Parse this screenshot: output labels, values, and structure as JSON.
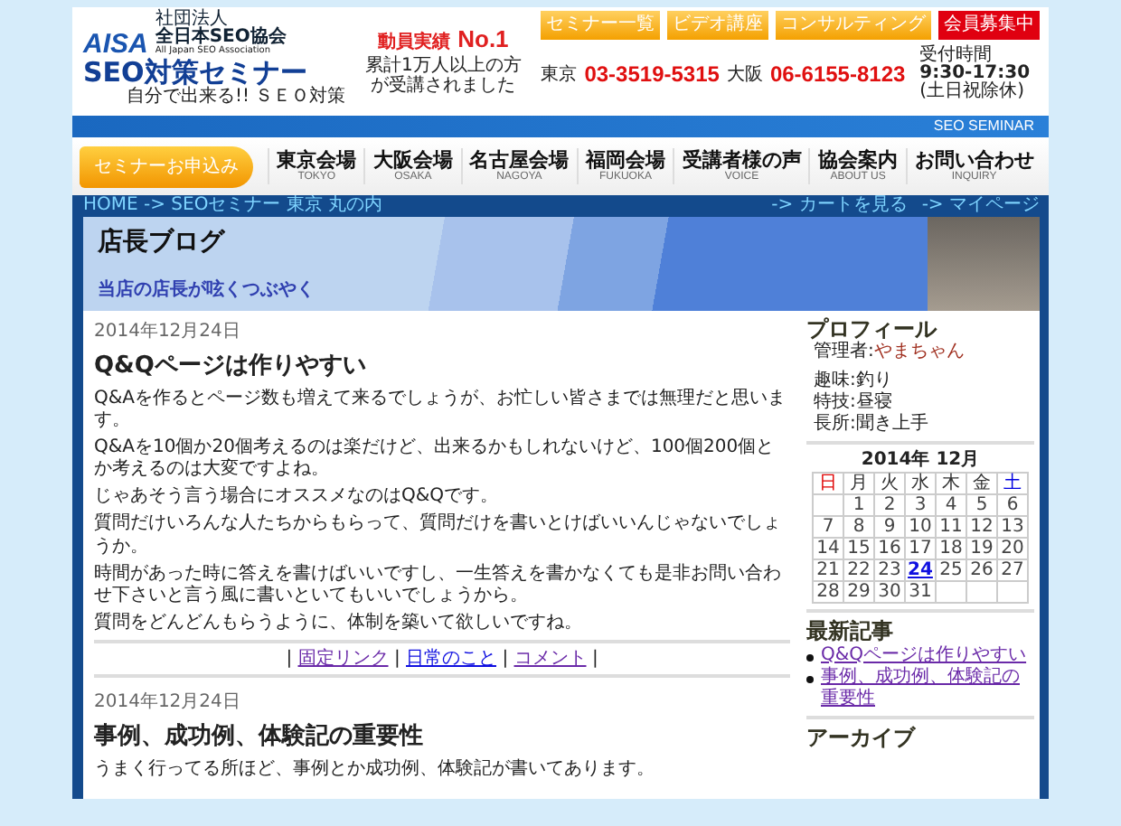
{
  "header": {
    "logo_mark": "AISA",
    "org_type": "社団法人",
    "org_name": "全日本SEO協会",
    "org_en": "All Japan SEO Association",
    "site_title": "SEO対策セミナー",
    "tagline": "自分で出来る!! ＳＥＯ対策",
    "award_label": "動員実績",
    "award_rank": "No.1",
    "award_text": "累計1万人以上の方が受講されました",
    "top_buttons": [
      {
        "label": "セミナー一覧",
        "kind": "normal"
      },
      {
        "label": "ビデオ講座",
        "kind": "normal"
      },
      {
        "label": "コンサルティング",
        "kind": "normal"
      },
      {
        "label": "会員募集中",
        "kind": "highlight"
      }
    ],
    "phones": [
      {
        "city": "東京",
        "number": "03-3519-5315"
      },
      {
        "city": "大阪",
        "number": "06-6155-8123"
      }
    ],
    "hours_label": "受付時間",
    "hours": "9:30-17:30",
    "hours_note": "(土日祝除休)",
    "band_text": "SEO SEMINAR"
  },
  "nav": {
    "cta": "セミナーお申込み",
    "items": [
      {
        "label": "東京会場",
        "sub": "TOKYO"
      },
      {
        "label": "大阪会場",
        "sub": "OSAKA"
      },
      {
        "label": "名古屋会場",
        "sub": "NAGOYA"
      },
      {
        "label": "福岡会場",
        "sub": "FUKUOKA"
      },
      {
        "label": "受講者様の声",
        "sub": "VOICE"
      },
      {
        "label": "協会案内",
        "sub": "ABOUT US"
      },
      {
        "label": "お問い合わせ",
        "sub": "INQUIRY"
      }
    ]
  },
  "breadcrumb": "HOME -> SEOセミナー 東京 丸の内",
  "utility_links": [
    "-> カートを見る",
    "-> マイページ"
  ],
  "banner": {
    "title": "店長ブログ",
    "subtitle": "当店の店長が呟くつぶやく"
  },
  "posts": [
    {
      "date": "2014年12月24日",
      "title": "Q&Qページは作りやすい",
      "paragraphs": [
        "Q&Aを作るとページ数も増えて来るでしょうが、お忙しい皆さまでは無理だと思います。",
        "Q&Aを10個か20個考えるのは楽だけど、出来るかもしれないけど、100個200個とか考えるのは大変ですよね。",
        "じゃあそう言う場合にオススメなのはQ&Qです。",
        "質問だけいろんな人たちからもらって、質問だけを書いとけばいいんじゃないでしょうか。",
        "時間があった時に答えを書けばいいですし、一生答えを書かなくても是非お問い合わせ下さいと言う風に書いといてもいいでしょうから。",
        "質問をどんどんもらうように、体制を築いて欲しいですね。"
      ],
      "separator": "|",
      "links": [
        {
          "label": "固定リンク",
          "visited": true
        },
        {
          "label": "日常のこと",
          "visited": false
        },
        {
          "label": "コメント",
          "visited": true
        }
      ]
    },
    {
      "date": "2014年12月24日",
      "title": "事例、成功例、体験記の重要性",
      "paragraphs": [
        "うまく行ってる所ほど、事例とか成功例、体験記が書いてあります。"
      ]
    }
  ],
  "sidebar": {
    "profile_title": "プロフィール",
    "admin_label": "管理者:",
    "admin_name": "やまちゃん",
    "details": [
      "趣味:釣り",
      "特技:昼寝",
      "長所:聞き上手"
    ],
    "calendar": {
      "title": "2014年 12月",
      "weekdays": [
        {
          "label": "日",
          "color": "#e00000"
        },
        {
          "label": "月",
          "color": "#333333"
        },
        {
          "label": "火",
          "color": "#333333"
        },
        {
          "label": "水",
          "color": "#333333"
        },
        {
          "label": "木",
          "color": "#333333"
        },
        {
          "label": "金",
          "color": "#333333"
        },
        {
          "label": "土",
          "color": "#0000e0"
        }
      ],
      "weeks": [
        [
          {
            "kind": "blank"
          },
          {
            "kind": "day",
            "day": "1",
            "linked": false
          },
          {
            "kind": "day",
            "day": "2",
            "linked": false
          },
          {
            "kind": "day",
            "day": "3",
            "linked": false
          },
          {
            "kind": "day",
            "day": "4",
            "linked": false
          },
          {
            "kind": "day",
            "day": "5",
            "linked": false
          },
          {
            "kind": "day",
            "day": "6",
            "linked": false
          }
        ],
        [
          {
            "kind": "day",
            "day": "7",
            "linked": false
          },
          {
            "kind": "day",
            "day": "8",
            "linked": false
          },
          {
            "kind": "day",
            "day": "9",
            "linked": false
          },
          {
            "kind": "day",
            "day": "10",
            "linked": false
          },
          {
            "kind": "day",
            "day": "11",
            "linked": false
          },
          {
            "kind": "day",
            "day": "12",
            "linked": false
          },
          {
            "kind": "day",
            "day": "13",
            "linked": false
          }
        ],
        [
          {
            "kind": "day",
            "day": "14",
            "linked": false
          },
          {
            "kind": "day",
            "day": "15",
            "linked": false
          },
          {
            "kind": "day",
            "day": "16",
            "linked": false
          },
          {
            "kind": "day",
            "day": "17",
            "linked": false
          },
          {
            "kind": "day",
            "day": "18",
            "linked": false
          },
          {
            "kind": "day",
            "day": "19",
            "linked": false
          },
          {
            "kind": "day",
            "day": "20",
            "linked": false
          }
        ],
        [
          {
            "kind": "day",
            "day": "21",
            "linked": false
          },
          {
            "kind": "day",
            "day": "22",
            "linked": false
          },
          {
            "kind": "day",
            "day": "23",
            "linked": false
          },
          {
            "kind": "day",
            "day": "24",
            "linked": true
          },
          {
            "kind": "day",
            "day": "25",
            "linked": false
          },
          {
            "kind": "day",
            "day": "26",
            "linked": false
          },
          {
            "kind": "day",
            "day": "27",
            "linked": false
          }
        ],
        [
          {
            "kind": "day",
            "day": "28",
            "linked": false
          },
          {
            "kind": "day",
            "day": "29",
            "linked": false
          },
          {
            "kind": "day",
            "day": "30",
            "linked": false
          },
          {
            "kind": "day",
            "day": "31",
            "linked": false
          },
          {
            "kind": "blank"
          },
          {
            "kind": "blank"
          },
          {
            "kind": "blank"
          }
        ]
      ]
    },
    "recent_title": "最新記事",
    "recent": [
      {
        "label": "Q&Qページは作りやすい",
        "visited": true
      },
      {
        "label": "事例、成功例、体験記の重要性",
        "visited": true
      }
    ],
    "archive_title": "アーカイブ"
  }
}
